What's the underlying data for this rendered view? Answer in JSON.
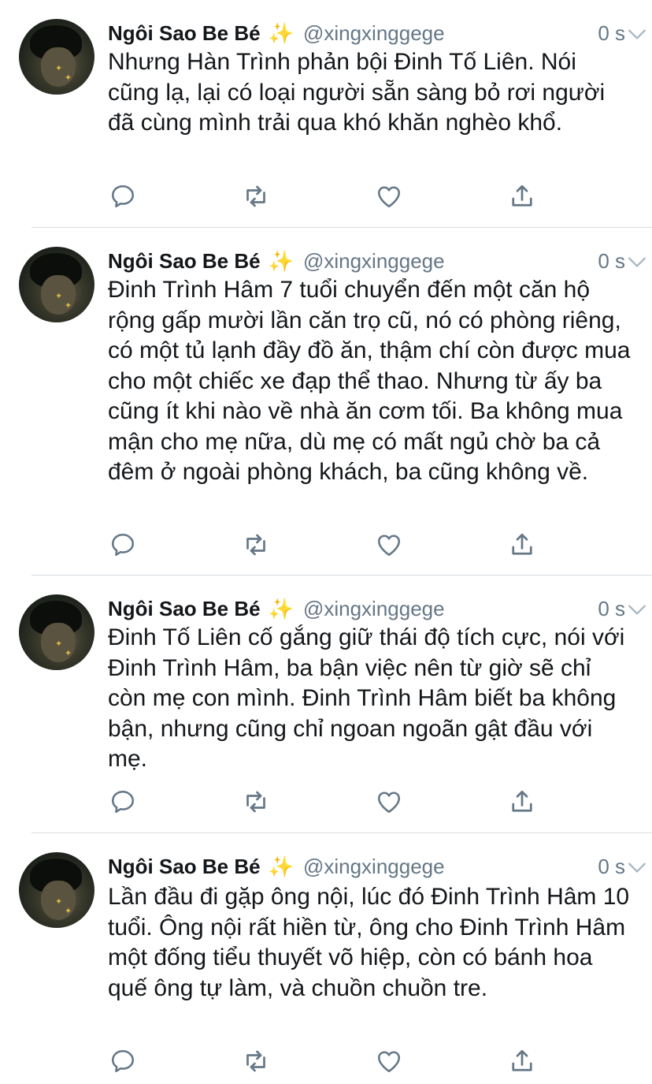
{
  "tweets": [
    {
      "name": "Ngôi Sao Be Bé",
      "emoji": "✨",
      "handle": "@xingxinggege",
      "time": "0 s",
      "text": "Nhưng Hàn Trình phản bội Đinh Tố Liên. Nói cũng lạ, lại có loại người sẵn sàng bỏ rơi người đã cùng mình trải qua khó khăn nghèo khổ."
    },
    {
      "name": "Ngôi Sao Be Bé",
      "emoji": "✨",
      "handle": "@xingxinggege",
      "time": "0 s",
      "text": "Đinh Trình Hâm 7 tuổi chuyển đến một căn hộ rộng gấp mười lần căn trọ cũ, nó có phòng riêng, có một tủ lạnh đầy đồ ăn, thậm chí còn được mua cho một chiếc xe đạp thể thao. Nhưng từ ấy ba cũng ít khi nào về nhà ăn cơm tối. Ba không mua mận cho mẹ nữa, dù mẹ có mất ngủ chờ ba cả đêm ở ngoài phòng khách, ba cũng không về."
    },
    {
      "name": "Ngôi Sao Be Bé",
      "emoji": "✨",
      "handle": "@xingxinggege",
      "time": "0 s",
      "text": "Đinh Tố Liên cố gắng giữ thái độ tích cực, nói với Đinh Trình Hâm, ba bận việc nên từ giờ sẽ chỉ còn mẹ con mình. Đinh Trình Hâm biết ba không bận, nhưng cũng chỉ ngoan ngoãn gật đầu với mẹ."
    },
    {
      "name": "Ngôi Sao Be Bé",
      "emoji": "✨",
      "handle": "@xingxinggege",
      "time": "0 s",
      "text": "Lần đầu đi gặp ông nội, lúc đó Đinh Trình Hâm 10 tuổi. Ông nội rất hiền từ, ông cho Đinh Trình Hâm một đống tiểu thuyết võ hiệp, còn có bánh hoa quế ông tự làm, và chuồn chuồn tre."
    }
  ],
  "icons": {
    "reply": "reply-icon",
    "retweet": "retweet-icon",
    "like": "like-icon",
    "share": "share-icon",
    "chevron": "chevron-down-icon"
  },
  "colors": {
    "text": "#14171a",
    "secondary": "#657786",
    "icon": "#657786",
    "divider": "#d8dde1"
  }
}
